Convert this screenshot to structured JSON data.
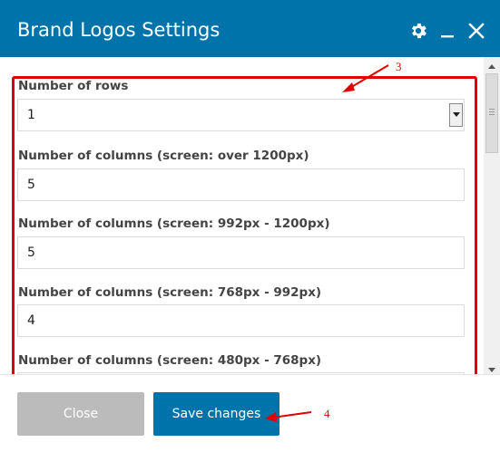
{
  "dialog": {
    "title": "Brand Logos Settings",
    "icons": [
      "gear-icon",
      "minimize-icon",
      "close-icon"
    ]
  },
  "fields": {
    "rows": {
      "label": "Number of rows",
      "value": "1"
    },
    "cols_over_1200": {
      "label": "Number of columns (screen: over 1200px)",
      "value": "5"
    },
    "cols_992_1200": {
      "label": "Number of columns (screen: 992px - 1200px)",
      "value": "5"
    },
    "cols_768_992": {
      "label": "Number of columns (screen: 768px - 992px)",
      "value": "4"
    },
    "cols_480_768": {
      "label": "Number of columns (screen: 480px - 768px)",
      "value": ""
    }
  },
  "footer": {
    "close_label": "Close",
    "save_label": "Save changes"
  },
  "annotations": {
    "marker_3": "3",
    "marker_4": "4"
  },
  "colors": {
    "header": "#0073aa",
    "primary_button": "#0073aa",
    "disabled_button": "#bbbbbb",
    "annotation": "#e00000"
  }
}
